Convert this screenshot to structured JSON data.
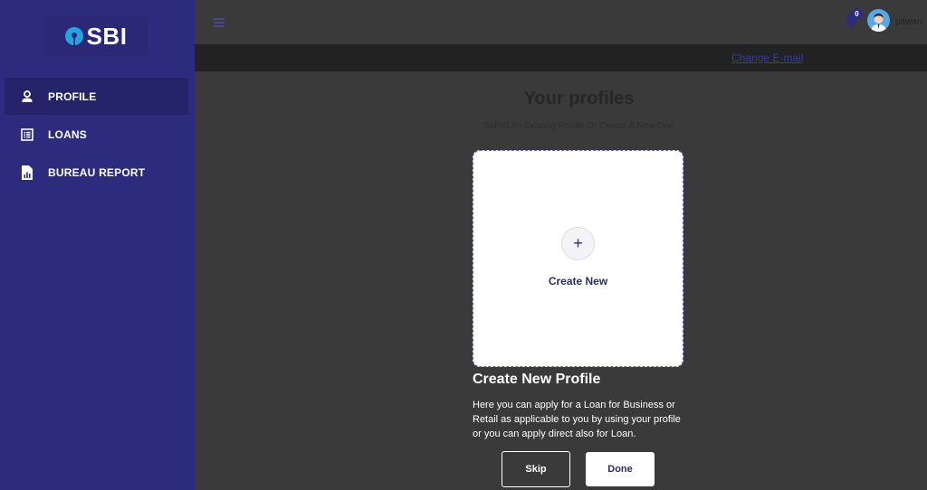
{
  "brand": {
    "logo_text": "SBI",
    "logo_color": "#22a6e0",
    "sidebar_color": "#2d2b7e"
  },
  "sidebar": {
    "items": [
      {
        "label": "PROFILE",
        "icon": "person-icon",
        "active": true
      },
      {
        "label": "LOANS",
        "icon": "list-icon",
        "active": false
      },
      {
        "label": "BUREAU REPORT",
        "icon": "report-icon",
        "active": false
      }
    ]
  },
  "header": {
    "notification_count": "0",
    "username": "pawan",
    "change_email_label": "Change E-mail"
  },
  "main": {
    "title": "Your profiles",
    "subtitle": "Select An Existing Profile Or Create A New One",
    "create_card_label": "Create New",
    "section_heading": "Create New Profile",
    "section_description": "Here you can apply for a Loan for Business or Retail as applicable to you by using your profile or you can apply direct also for Loan.",
    "skip_label": "Skip",
    "done_label": "Done"
  }
}
